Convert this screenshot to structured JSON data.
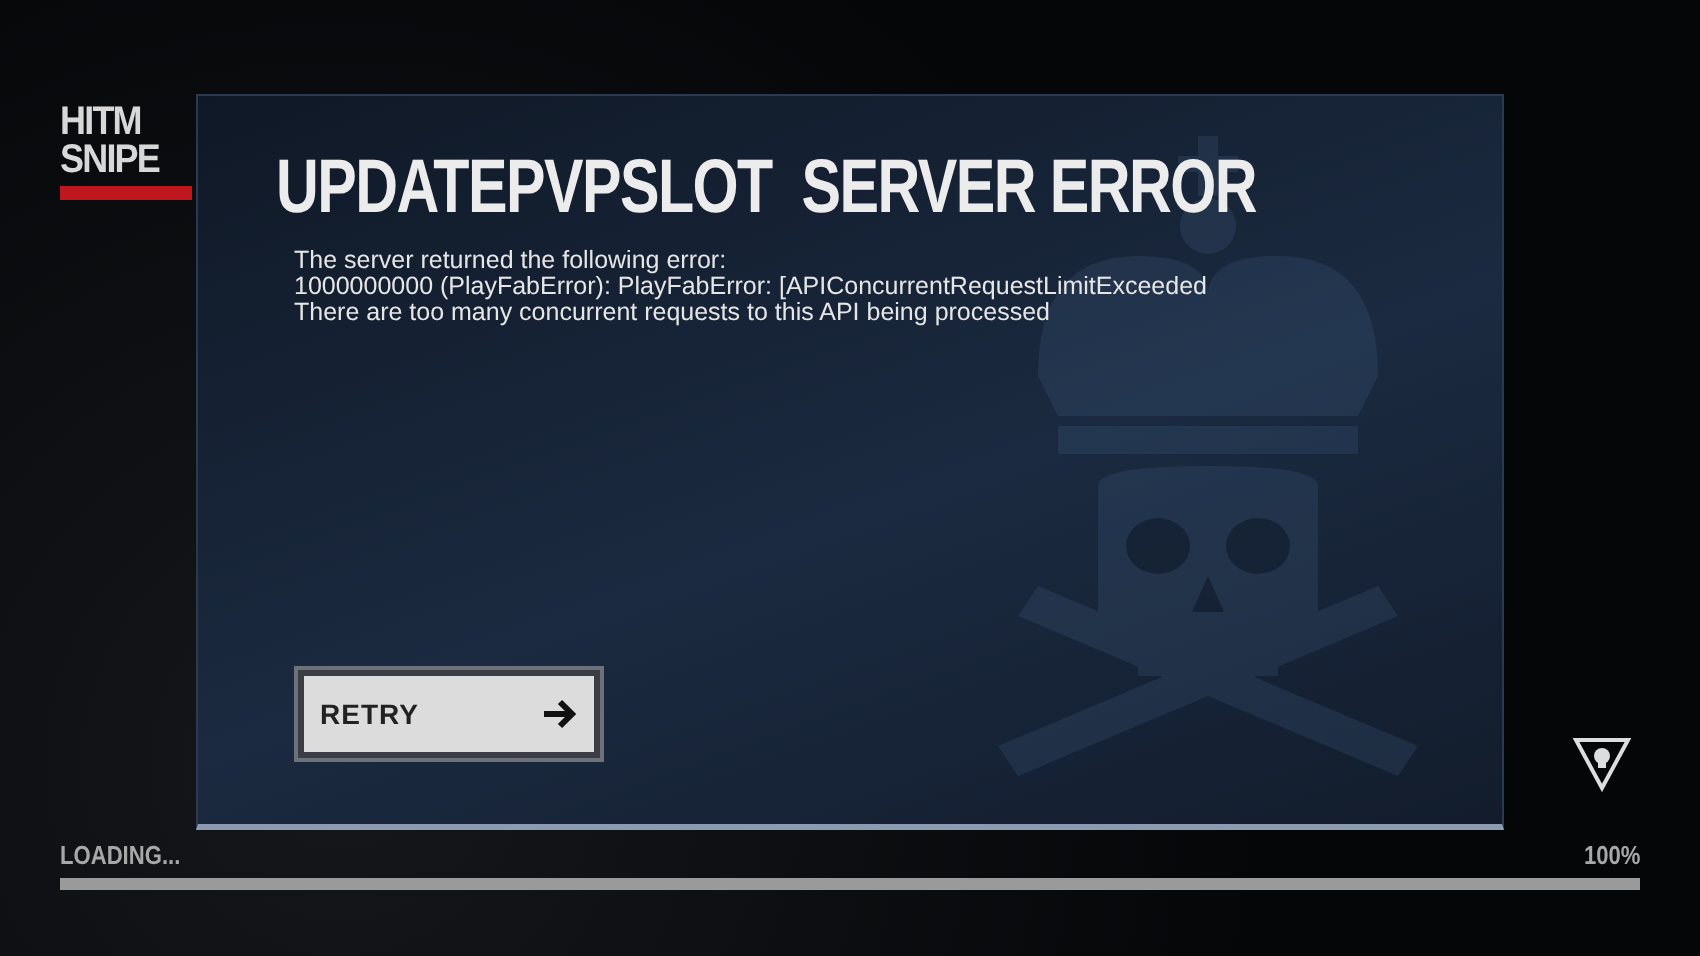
{
  "logo": {
    "lines": [
      "HITM",
      "SNIPE"
    ]
  },
  "dialog": {
    "title": "UPDATEPVPSLOT  SERVER ERROR",
    "message": [
      "The server returned the following error:",
      "1000000000 (PlayFabError): PlayFabError: [APIConcurrentRequestLimitExceeded",
      "There are too many concurrent requests to this API being processed"
    ],
    "button": "RETRY"
  },
  "loading": {
    "label": "LOADING...",
    "percent": "100%",
    "level": 1
  }
}
